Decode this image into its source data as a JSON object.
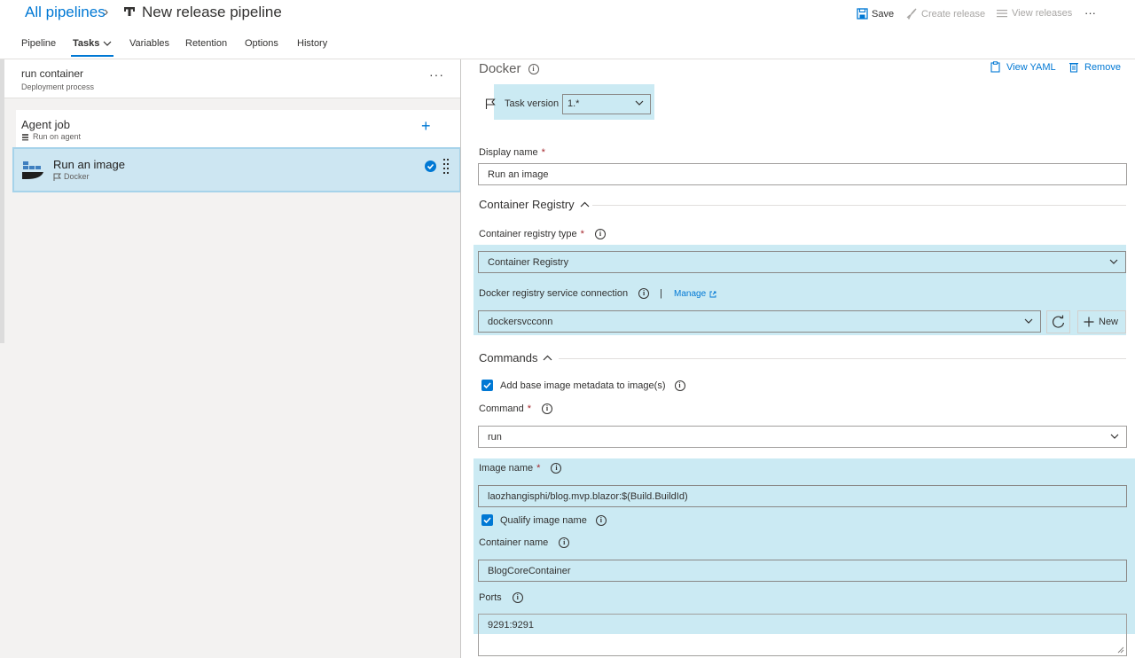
{
  "header": {
    "breadcrumb": "All pipelines",
    "breadcrumb_sep": "›",
    "pipeline_title": "New release pipeline",
    "save_label": "Save",
    "create_release_label": "Create release",
    "view_releases_label": "View releases",
    "more_label": "···"
  },
  "tabs": [
    "Pipeline",
    "Tasks",
    "Variables",
    "Retention",
    "Options",
    "History"
  ],
  "left": {
    "stage_title": "run container",
    "stage_subtitle": "Deployment process",
    "stage_more": "···",
    "agent_title": "Agent job",
    "agent_subtitle": "Run on agent",
    "agent_add": "+",
    "task_title": "Run an image",
    "task_subtitle": "Docker"
  },
  "task": {
    "title": "Docker",
    "view_yaml_label": "View YAML",
    "remove_label": "Remove",
    "task_version_label": "Task version",
    "task_version_value": "1.*",
    "display_name_label": "Display name",
    "display_name_value": "Run an image",
    "container_registry_section": "Container Registry",
    "registry_type_label": "Container registry type",
    "registry_type_value": "Container Registry",
    "service_conn_label": "Docker registry service connection",
    "manage_label": "Manage",
    "service_conn_value": "dockersvcconn",
    "new_label": "New",
    "commands_section": "Commands",
    "add_metadata_label": "Add base image metadata to image(s)",
    "command_label": "Command",
    "command_value": "run",
    "image_name_label": "Image name",
    "image_name_value": "laozhangisphi/blog.mvp.blazor:$(Build.BuildId)",
    "qualify_label": "Qualify image name",
    "container_name_label": "Container name",
    "container_name_value": "BlogCoreContainer",
    "ports_label": "Ports",
    "ports_value": "9291:9291",
    "required_mark": "*",
    "info_glyph": "i",
    "separator": "|"
  },
  "colors": {
    "accent": "#0078d4",
    "highlight": "#cbeaf3",
    "selected_task": "#cde6f2"
  }
}
